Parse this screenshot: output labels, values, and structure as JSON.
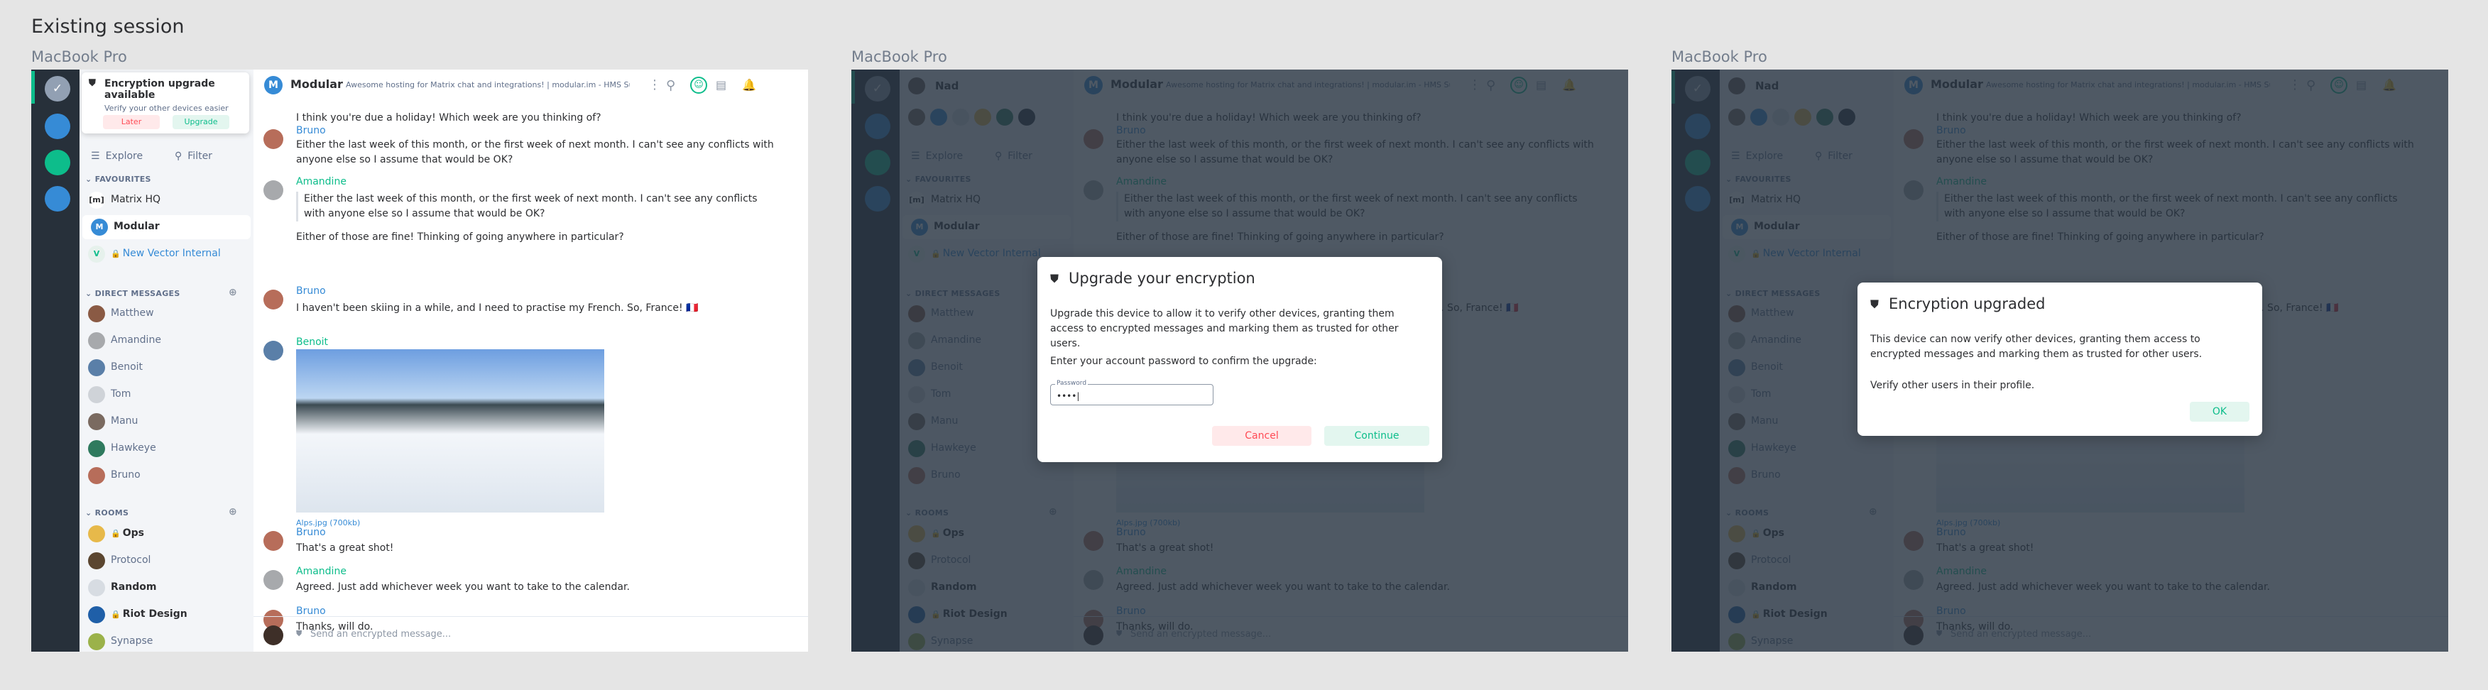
{
  "page_title": "Existing session",
  "frames": [
    {
      "label": "MacBook Pro"
    },
    {
      "label": "MacBook Pro"
    },
    {
      "label": "MacBook Pro"
    }
  ],
  "home_glyph": "✓",
  "toast": {
    "title": "Encryption upgrade available",
    "subtitle": "Verify your other devices easier",
    "later": "Later",
    "upgrade": "Upgrade",
    "icon": "shield-icon"
  },
  "nav": {
    "explore": "Explore",
    "filter": "Filter",
    "explore_glyph": "☰",
    "filter_glyph": "⚲"
  },
  "favourites": {
    "heading": "FAVOURITES",
    "items": [
      {
        "label": "Matrix HQ",
        "color": "#ffffff",
        "glyph": "[m]"
      },
      {
        "label": "Modular",
        "color": "#368bd6",
        "glyph": "M"
      },
      {
        "label": "New Vector Internal",
        "color": "#e6f1ec",
        "glyph": "V"
      }
    ]
  },
  "dms": {
    "heading": "DIRECT MESSAGES",
    "items": [
      {
        "label": "Matthew",
        "color": "#8a5a44"
      },
      {
        "label": "Amandine",
        "color": "#a7a9ac"
      },
      {
        "label": "Benoit",
        "color": "#5a7fa8"
      },
      {
        "label": "Tom",
        "color": "#cfd3d8"
      },
      {
        "label": "Manu",
        "color": "#7a6a60"
      },
      {
        "label": "Hawkeye",
        "color": "#2f7a5e"
      },
      {
        "label": "Bruno",
        "color": "#b76d5a"
      }
    ]
  },
  "rooms": {
    "heading": "ROOMS",
    "items": [
      {
        "label": "Ops",
        "color": "#e7b94a",
        "bold": true
      },
      {
        "label": "Protocol",
        "color": "#5b4630",
        "bold": false
      },
      {
        "label": "Random",
        "color": "#d7dce2",
        "bold": true
      },
      {
        "label": "Riot Design",
        "color": "#1f5fa8",
        "bold": true
      },
      {
        "label": "Synapse",
        "color": "#9bb24a",
        "bold": false
      }
    ]
  },
  "room": {
    "name": "Modular",
    "avatar_glyph": "M",
    "topic": "Awesome hosting for Matrix chat and integrations! | modular.im - HMS Survey ",
    "topic_link": "https://surve...",
    "more_glyph": "⋮"
  },
  "messages": [
    {
      "type": "text",
      "body": "I think you're due a holiday! Which week are you thinking of?"
    },
    {
      "type": "msg",
      "sender": "Bruno",
      "sender_color": "#368bd6",
      "avatar": "#b76d5a",
      "body": "Either the last week of this month, or the first week of next month. I can't see any conflicts with anyone else so I assume that would be OK?"
    },
    {
      "type": "msg",
      "sender": "Amandine",
      "sender_color": "#0dbd8b",
      "avatar": "#a7a9ac",
      "quote": "Either the last week of this month, or the first week of next month. I can't see any conflicts with anyone else so I assume that would be OK?",
      "body": "Either of those are fine! Thinking of going anywhere in particular?"
    },
    {
      "type": "msg",
      "sender": "Bruno",
      "sender_color": "#368bd6",
      "avatar": "#b76d5a",
      "body": "I haven't been skiing in a while, and I need to practise my French. So, France! 🇫🇷"
    },
    {
      "type": "image",
      "sender": "Benoit",
      "sender_color": "#0dbd8b",
      "avatar": "#5a7fa8",
      "file": "Alps.jpg (700kb)"
    },
    {
      "type": "msg",
      "sender": "Bruno",
      "sender_color": "#368bd6",
      "avatar": "#b76d5a",
      "body": "That's a great shot!"
    },
    {
      "type": "msg",
      "sender": "Amandine",
      "sender_color": "#0dbd8b",
      "avatar": "#a7a9ac",
      "body": "Agreed. Just add whichever week you want to take to the calendar."
    },
    {
      "type": "msg",
      "sender": "Bruno",
      "sender_color": "#368bd6",
      "avatar": "#b76d5a",
      "body": "Thanks, will do."
    }
  ],
  "composer": {
    "placeholder": "Send an encrypted message..."
  },
  "sidebar_user": {
    "name": "Nad"
  },
  "upgrade_dialog": {
    "title": "Upgrade your encryption",
    "text": "Upgrade this device to allow it to verify other devices, granting them access to encrypted messages and marking them as trusted for other users.",
    "prompt": "Enter your account password to confirm the upgrade:",
    "password_label": "Password",
    "password_value": "••••|",
    "cancel": "Cancel",
    "continue": "Continue"
  },
  "upgraded_dialog": {
    "title": "Encryption upgraded",
    "text": "This device can now verify other devices, granting them access to encrypted messages and marking them as trusted for other users.",
    "text2": "Verify other users in their profile.",
    "ok": "OK"
  },
  "colors": {
    "accent": "#0dbd8b",
    "link": "#368bd6",
    "danger": "#ff4b55",
    "sidebar": "#27303a"
  }
}
